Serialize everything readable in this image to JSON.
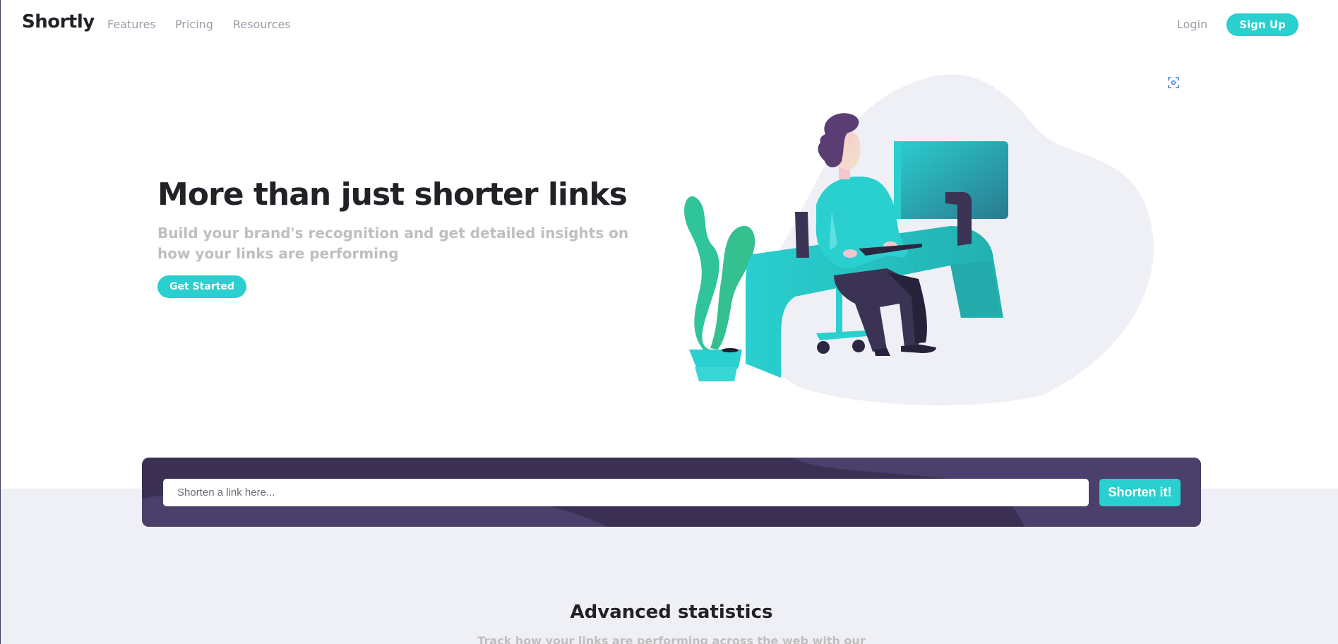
{
  "header": {
    "logo": "Shortly",
    "nav": [
      "Features",
      "Pricing",
      "Resources"
    ],
    "login": "Login",
    "signup": "Sign Up"
  },
  "hero": {
    "title": "More than just shorter links",
    "subtitle": "Build your brand's recognition and get detailed insights on how your links are performing",
    "cta": "Get Started"
  },
  "shorten": {
    "placeholder": "Shorten a link here...",
    "button": "Shorten it!"
  },
  "stats": {
    "title": "Advanced statistics",
    "subtitle": "Track how your links are performing across the web with our"
  },
  "colors": {
    "accent": "#2acfcf",
    "dark_violet": "#3b3054",
    "text_dark": "#232127",
    "text_gray": "#bfbfbf",
    "bg_light": "#eff0f5"
  },
  "icons": {
    "corner": "scan-icon"
  }
}
